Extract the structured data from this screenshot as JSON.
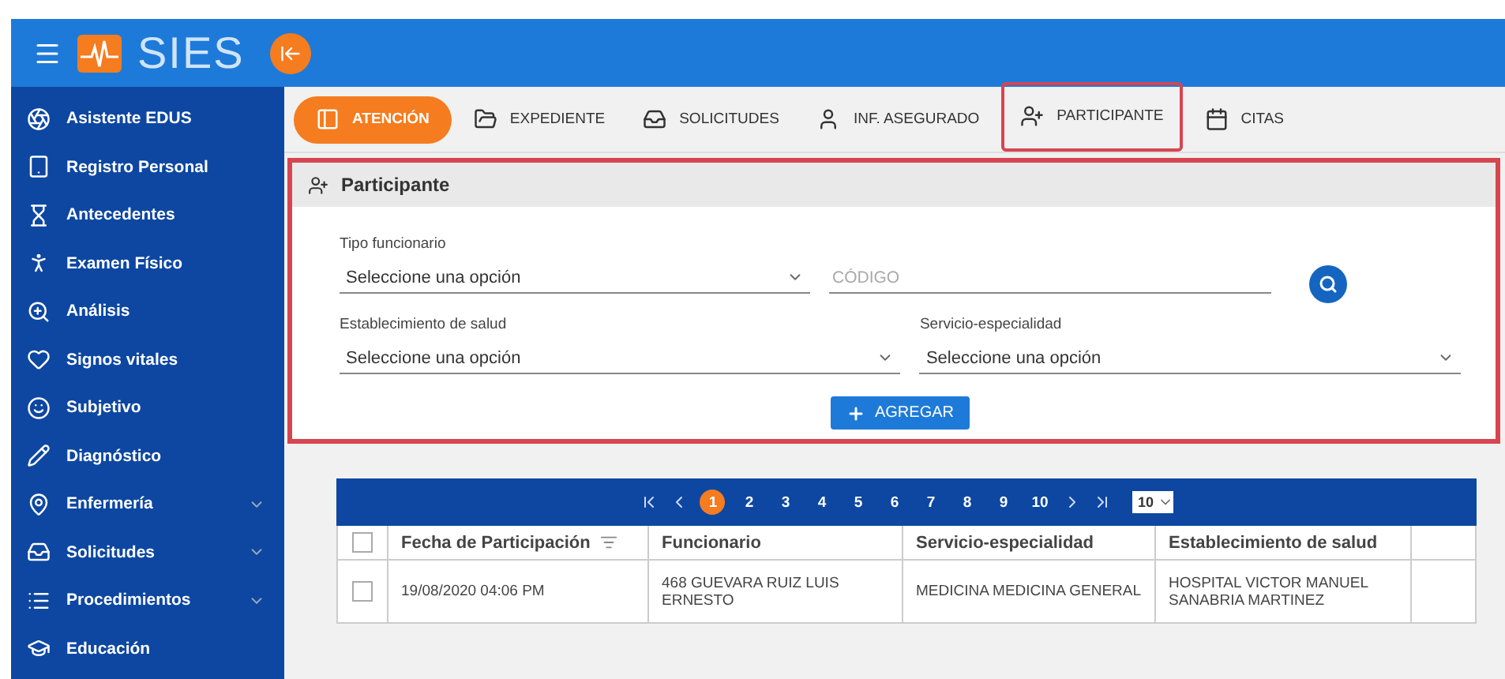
{
  "app": {
    "title": "SIES"
  },
  "sidebar": {
    "items": [
      {
        "label": "Asistente EDUS",
        "expandable": false
      },
      {
        "label": "Registro Personal",
        "expandable": false
      },
      {
        "label": "Antecedentes",
        "expandable": false
      },
      {
        "label": "Examen Físico",
        "expandable": false
      },
      {
        "label": "Análisis",
        "expandable": false
      },
      {
        "label": "Signos vitales",
        "expandable": false
      },
      {
        "label": "Subjetivo",
        "expandable": false
      },
      {
        "label": "Diagnóstico",
        "expandable": false
      },
      {
        "label": "Enfermería",
        "expandable": true
      },
      {
        "label": "Solicitudes",
        "expandable": true
      },
      {
        "label": "Procedimientos",
        "expandable": true
      },
      {
        "label": "Educación",
        "expandable": false
      }
    ]
  },
  "tabs": [
    {
      "label": "ATENCIÓN",
      "selected": true,
      "highlighted": false
    },
    {
      "label": "EXPEDIENTE",
      "selected": false,
      "highlighted": false
    },
    {
      "label": "SOLICITUDES",
      "selected": false,
      "highlighted": false
    },
    {
      "label": "INF. ASEGURADO",
      "selected": false,
      "highlighted": false
    },
    {
      "label": "PARTICIPANTE",
      "selected": false,
      "highlighted": true
    },
    {
      "label": "CITAS",
      "selected": false,
      "highlighted": false
    }
  ],
  "panel": {
    "title": "Participante",
    "highlighted": true,
    "tipo_funcionario": {
      "label": "Tipo funcionario",
      "value": "Seleccione una opción"
    },
    "codigo": {
      "placeholder": "CÓDIGO"
    },
    "establecimiento": {
      "label": "Establecimiento de salud",
      "value": "Seleccione una opción"
    },
    "servicio": {
      "label": "Servicio-especialidad",
      "value": "Seleccione una opción"
    },
    "add_button": "AGREGAR"
  },
  "pagination": {
    "pages": [
      {
        "label": "1",
        "selected": true
      },
      {
        "label": "2",
        "selected": false
      },
      {
        "label": "3",
        "selected": false
      },
      {
        "label": "4",
        "selected": false
      },
      {
        "label": "5",
        "selected": false
      },
      {
        "label": "6",
        "selected": false
      },
      {
        "label": "7",
        "selected": false
      },
      {
        "label": "8",
        "selected": false
      },
      {
        "label": "9",
        "selected": false
      },
      {
        "label": "10",
        "selected": false
      }
    ],
    "page_size": "10"
  },
  "table": {
    "all_checked": false,
    "columns": [
      "Fecha de Participación",
      "Funcionario",
      "Servicio-especialidad",
      "Establecimiento de salud"
    ],
    "rows": [
      {
        "checked": false,
        "cells": [
          "19/08/2020 04:06 PM",
          "468 GUEVARA RUIZ LUIS ERNESTO",
          "MEDICINA MEDICINA GENERAL",
          "HOSPITAL VICTOR MANUEL SANABRIA MARTINEZ"
        ]
      }
    ]
  }
}
